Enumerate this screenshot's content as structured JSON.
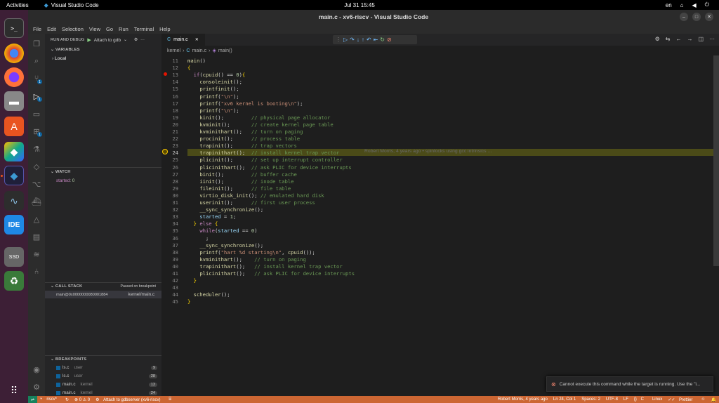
{
  "topbar": {
    "activities": "Activities",
    "app_name": "Visual Studio Code",
    "clock": "Jul 31  15:45",
    "lang": "en"
  },
  "window": {
    "title": "main.c - xv6-riscv - Visual Studio Code"
  },
  "menu": [
    "File",
    "Edit",
    "Selection",
    "View",
    "Go",
    "Run",
    "Terminal",
    "Help"
  ],
  "sidebar": {
    "run_debug_label": "RUN AND DEBUG",
    "config": "Attach to gdb",
    "variables_head": "VARIABLES",
    "local": "Local",
    "watch_head": "WATCH",
    "watch_items": [
      {
        "name": "started",
        "value": "0"
      }
    ],
    "callstack_head": "CALL STACK",
    "callstack_state": "Paused on breakpoint",
    "callstack_items": [
      {
        "frame": "main@0x0000000080001884",
        "file": "kernel/main.c"
      }
    ],
    "breakpoints_head": "BREAKPOINTS",
    "breakpoints": [
      {
        "file": "ls.c",
        "dir": "user",
        "line": "9"
      },
      {
        "file": "ls.c",
        "dir": "user",
        "line": "28"
      },
      {
        "file": "main.c",
        "dir": "kernel",
        "line": "13"
      },
      {
        "file": "main.c",
        "dir": "kernel",
        "line": "24"
      }
    ]
  },
  "activity_badges": {
    "scm": "1",
    "debug": "1",
    "ext": "1"
  },
  "tab": {
    "label": "main.c"
  },
  "breadcrumb": {
    "folder": "kernel",
    "file": "main.c",
    "symbol": "main()"
  },
  "editor": {
    "lines": [
      {
        "n": "11",
        "t": "main()"
      },
      {
        "n": "12",
        "t": "{"
      },
      {
        "n": "13",
        "t": "  if(cpuid() == 0){"
      },
      {
        "n": "14",
        "t": "    consoleinit();"
      },
      {
        "n": "15",
        "t": "    printfinit();"
      },
      {
        "n": "16",
        "t": "    printf(\"\\n\");"
      },
      {
        "n": "17",
        "t": "    printf(\"xv6 kernel is booting\\n\");"
      },
      {
        "n": "18",
        "t": "    printf(\"\\n\");"
      },
      {
        "n": "19",
        "t": "    kinit();         // physical page allocator"
      },
      {
        "n": "20",
        "t": "    kvminit();       // create kernel page table"
      },
      {
        "n": "21",
        "t": "    kvminithart();   // turn on paging"
      },
      {
        "n": "22",
        "t": "    procinit();      // process table"
      },
      {
        "n": "23",
        "t": "    trapinit();      // trap vectors"
      },
      {
        "n": "24",
        "t": "    trapinithart();  // install kernel trap vector"
      },
      {
        "n": "25",
        "t": "    plicinit();      // set up interrupt controller"
      },
      {
        "n": "26",
        "t": "    plicinithart();  // ask PLIC for device interrupts"
      },
      {
        "n": "27",
        "t": "    binit();         // buffer cache"
      },
      {
        "n": "28",
        "t": "    iinit();         // inode table"
      },
      {
        "n": "29",
        "t": "    fileinit();      // file table"
      },
      {
        "n": "30",
        "t": "    virtio_disk_init(); // emulated hard disk"
      },
      {
        "n": "31",
        "t": "    userinit();      // first user process"
      },
      {
        "n": "32",
        "t": "    __sync_synchronize();"
      },
      {
        "n": "33",
        "t": "    started = 1;"
      },
      {
        "n": "34",
        "t": "  } else {"
      },
      {
        "n": "35",
        "t": "    while(started == 0)"
      },
      {
        "n": "36",
        "t": "      ;"
      },
      {
        "n": "37",
        "t": "    __sync_synchronize();"
      },
      {
        "n": "38",
        "t": "    printf(\"hart %d starting\\n\", cpuid());"
      },
      {
        "n": "39",
        "t": "    kvminithart();    // turn on paging"
      },
      {
        "n": "40",
        "t": "    trapinithart();   // install kernel trap vector"
      },
      {
        "n": "41",
        "t": "    plicinithart();   // ask PLIC for device interrupts"
      },
      {
        "n": "42",
        "t": "  }"
      },
      {
        "n": "43",
        "t": ""
      },
      {
        "n": "44",
        "t": "  scheduler();"
      },
      {
        "n": "45",
        "t": "}"
      }
    ],
    "blame": "Robert Morris, 4 years ago • spinlocks using gcc intrinsics …"
  },
  "statusbar": {
    "branch": "riscv*",
    "problems": "⊗ 0 ⚠ 0",
    "debug": "Attach to gdbserver (xv6-riscv)",
    "blame": "Robert Morris, 4 years ago",
    "position": "Ln 24, Col 1",
    "spaces": "Spaces: 2",
    "encoding": "UTF-8",
    "eol": "LF",
    "lang": "C",
    "os": "Linux",
    "prettier": "Prettier"
  },
  "toast": {
    "message": "Cannot execute this command while the target is running. Use the \"i..."
  },
  "colors": {
    "statusbar": "#cc6633",
    "highlight": "#4b4b18",
    "breakpoint": "#e51400"
  }
}
